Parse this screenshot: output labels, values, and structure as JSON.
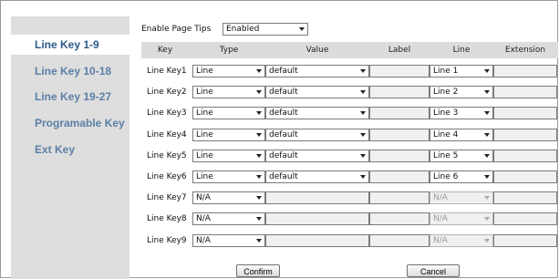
{
  "sidebar": {
    "items": [
      {
        "label": "Line Key 1-9",
        "active": true
      },
      {
        "label": "Line Key 10-18",
        "active": false
      },
      {
        "label": "Line Key 19-27",
        "active": false
      },
      {
        "label": "Programable Key",
        "active": false
      },
      {
        "label": "Ext Key",
        "active": false
      }
    ]
  },
  "top": {
    "tips_label": "Enable Page Tips",
    "tips_value": "Enabled"
  },
  "table": {
    "headers": {
      "key": "Key",
      "type": "Type",
      "value": "Value",
      "label": "Label",
      "line": "Line",
      "extension": "Extension"
    },
    "rows": [
      {
        "key": "Line Key1",
        "type": "Line",
        "value": "default",
        "label": "",
        "line": "Line 1",
        "extension": "",
        "enabled": true
      },
      {
        "key": "Line Key2",
        "type": "Line",
        "value": "default",
        "label": "",
        "line": "Line 2",
        "extension": "",
        "enabled": true
      },
      {
        "key": "Line Key3",
        "type": "Line",
        "value": "default",
        "label": "",
        "line": "Line 3",
        "extension": "",
        "enabled": true
      },
      {
        "key": "Line Key4",
        "type": "Line",
        "value": "default",
        "label": "",
        "line": "Line 4",
        "extension": "",
        "enabled": true
      },
      {
        "key": "Line Key5",
        "type": "Line",
        "value": "default",
        "label": "",
        "line": "Line 5",
        "extension": "",
        "enabled": true
      },
      {
        "key": "Line Key6",
        "type": "Line",
        "value": "default",
        "label": "",
        "line": "Line 6",
        "extension": "",
        "enabled": true
      },
      {
        "key": "Line Key7",
        "type": "N/A",
        "value": "",
        "label": "",
        "line": "N/A",
        "extension": "",
        "enabled": false
      },
      {
        "key": "Line Key8",
        "type": "N/A",
        "value": "",
        "label": "",
        "line": "N/A",
        "extension": "",
        "enabled": false
      },
      {
        "key": "Line Key9",
        "type": "N/A",
        "value": "",
        "label": "",
        "line": "N/A",
        "extension": "",
        "enabled": false
      }
    ]
  },
  "buttons": {
    "confirm": "Confirm",
    "cancel": "Cancel"
  },
  "colors": {
    "sidebar_bg": "#dedede",
    "sidebar_text": "#5b7fa6",
    "sidebar_active_text": "#2e5a8a",
    "header_bg": "#dcdcdc"
  }
}
